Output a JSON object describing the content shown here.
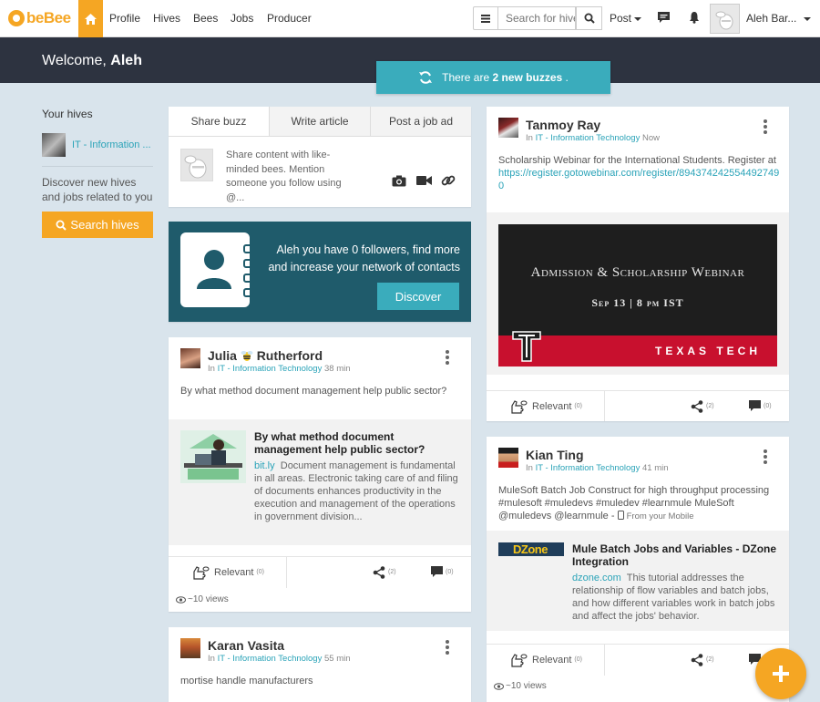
{
  "nav": {
    "logo_text": "beBee",
    "links": [
      "Profile",
      "Hives",
      "Bees",
      "Jobs",
      "Producer"
    ],
    "search_placeholder": "Search for hives",
    "post_label": "Post",
    "user_name": "Aleh Bar...",
    "brand_color": "#f5a623"
  },
  "welcome": {
    "prefix": "Welcome,",
    "name": "Aleh"
  },
  "new_buzzes": {
    "prefix": "There are",
    "highlight": "2 new buzzes",
    "suffix": "."
  },
  "sidebar": {
    "your_hives": "Your hives",
    "hive_label": "IT - Information ...",
    "discover_text": "Discover new hives and jobs related to you",
    "search_hives": "Search hives"
  },
  "share": {
    "tabs": [
      "Share buzz",
      "Write article",
      "Post a job ad"
    ],
    "prompt": "Share content with like-minded bees. Mention someone you follow using @..."
  },
  "followers": {
    "text": "Aleh you have 0 followers, find more and increase your network of contacts",
    "button": "Discover"
  },
  "posts": [
    {
      "author_first": "Julia",
      "author_last": "Rutherford",
      "in": "In",
      "hive": "IT - Information Technology",
      "time": "38 min",
      "text": "By what method document management help public sector?",
      "link_title": "By what method document management help public sector?",
      "link_domain": "bit.ly",
      "link_desc": "Document management is fundamental in all areas. Electronic taking care of and filing of documents enhances productivity in the execution and management of the operations in government division...",
      "relevant": "Relevant",
      "relevant_count": "(0)",
      "shares": "(2)",
      "comments": "(0)",
      "views": "~10 views"
    },
    {
      "author": "Karan Vasita",
      "in": "In",
      "hive": "IT - Information Technology",
      "time": "55 min",
      "text": "mortise handle manufacturers"
    },
    {
      "author": "Tanmoy Ray",
      "in": "In",
      "hive": "IT - Information Technology",
      "time": "Now",
      "text": "Scholarship Webinar for the International Students. Register at",
      "url": "https://register.gotowebinar.com/register/8943742425544927490",
      "banner_title": "Admission & Scholarship Webinar",
      "banner_date": "Sep 13 | 8 pm IST",
      "banner_school": "TEXAS TECH",
      "relevant": "Relevant",
      "relevant_count": "(0)",
      "shares": "(2)",
      "comments": "(0)"
    },
    {
      "author": "Kian Ting",
      "in": "In",
      "hive": "IT - Information Technology",
      "time": "41 min",
      "text": "MuleSoft Batch Job Construct for high throughput processing #mulesoft #muledevs #muledev #learnmule MuleSoft @muledevs @learnmule -",
      "from_mobile": "From your Mobile",
      "link_logo": "DZone",
      "link_title": "Mule Batch Jobs and Variables - DZone Integration",
      "link_domain": "dzone.com",
      "link_desc": "This tutorial addresses the relationship of flow variables and batch jobs, and how different variables work in batch jobs and affect the jobs' behavior.",
      "relevant": "Relevant",
      "relevant_count": "(0)",
      "shares": "(2)",
      "views": "~10 views"
    }
  ]
}
